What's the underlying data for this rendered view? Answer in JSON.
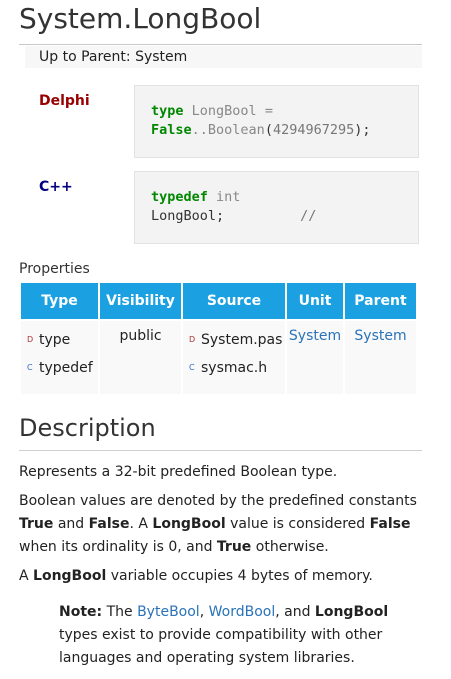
{
  "title": "System.LongBool",
  "parent": {
    "prefix": "Up to Parent:",
    "name": "System"
  },
  "delphi": {
    "label": "Delphi",
    "kw_type": "type",
    "ident": "LongBool",
    "eq": " =",
    "kw_false": "False",
    "range": "..",
    "base": "Boolean",
    "open": "(",
    "value": "4294967295",
    "close": ");"
  },
  "cpp": {
    "label": "C++",
    "kw_typedef": "typedef",
    "type_int": "int",
    "ident": "LongBool;",
    "comment": "//"
  },
  "properties": {
    "label": "Properties",
    "headers": [
      "Type",
      "Visibility",
      "Source",
      "Unit",
      "Parent"
    ],
    "type_items": [
      {
        "marker": "D",
        "text": "type"
      },
      {
        "marker": "C",
        "text": "typedef"
      }
    ],
    "visibility": "public",
    "source_items": [
      {
        "marker": "D",
        "text": "System.pas"
      },
      {
        "marker": "C",
        "text": "sysmac.h"
      }
    ],
    "unit": "System",
    "parent": "System"
  },
  "description": {
    "heading": "Description",
    "p1": "Represents a 32-bit predefined Boolean type.",
    "p2": {
      "a": "Boolean values are denoted by the predefined constants ",
      "true1": "True",
      "b": " and ",
      "false1": "False",
      "c": ". A ",
      "longbool1": "LongBool",
      "d": " value is considered ",
      "false2": "False",
      "e": " when its ordinality is 0, and ",
      "true2": "True",
      "f": " otherwise."
    },
    "p3": {
      "a": "A ",
      "longbool": "LongBool",
      "b": " variable occupies 4 bytes of memory."
    },
    "note": {
      "label": "Note:",
      "a": " The ",
      "link1": "ByteBool",
      "b": ", ",
      "link2": "WordBool",
      "c": ", and ",
      "longbool": "LongBool",
      "d": " types exist to provide compatibility with other languages and operating system libraries."
    }
  },
  "colors": {
    "header_bg": "#1ba1e2",
    "link": "#2a73b8",
    "delphi_label": "#990000",
    "cpp_label": "#000080",
    "keyword": "#008800"
  }
}
